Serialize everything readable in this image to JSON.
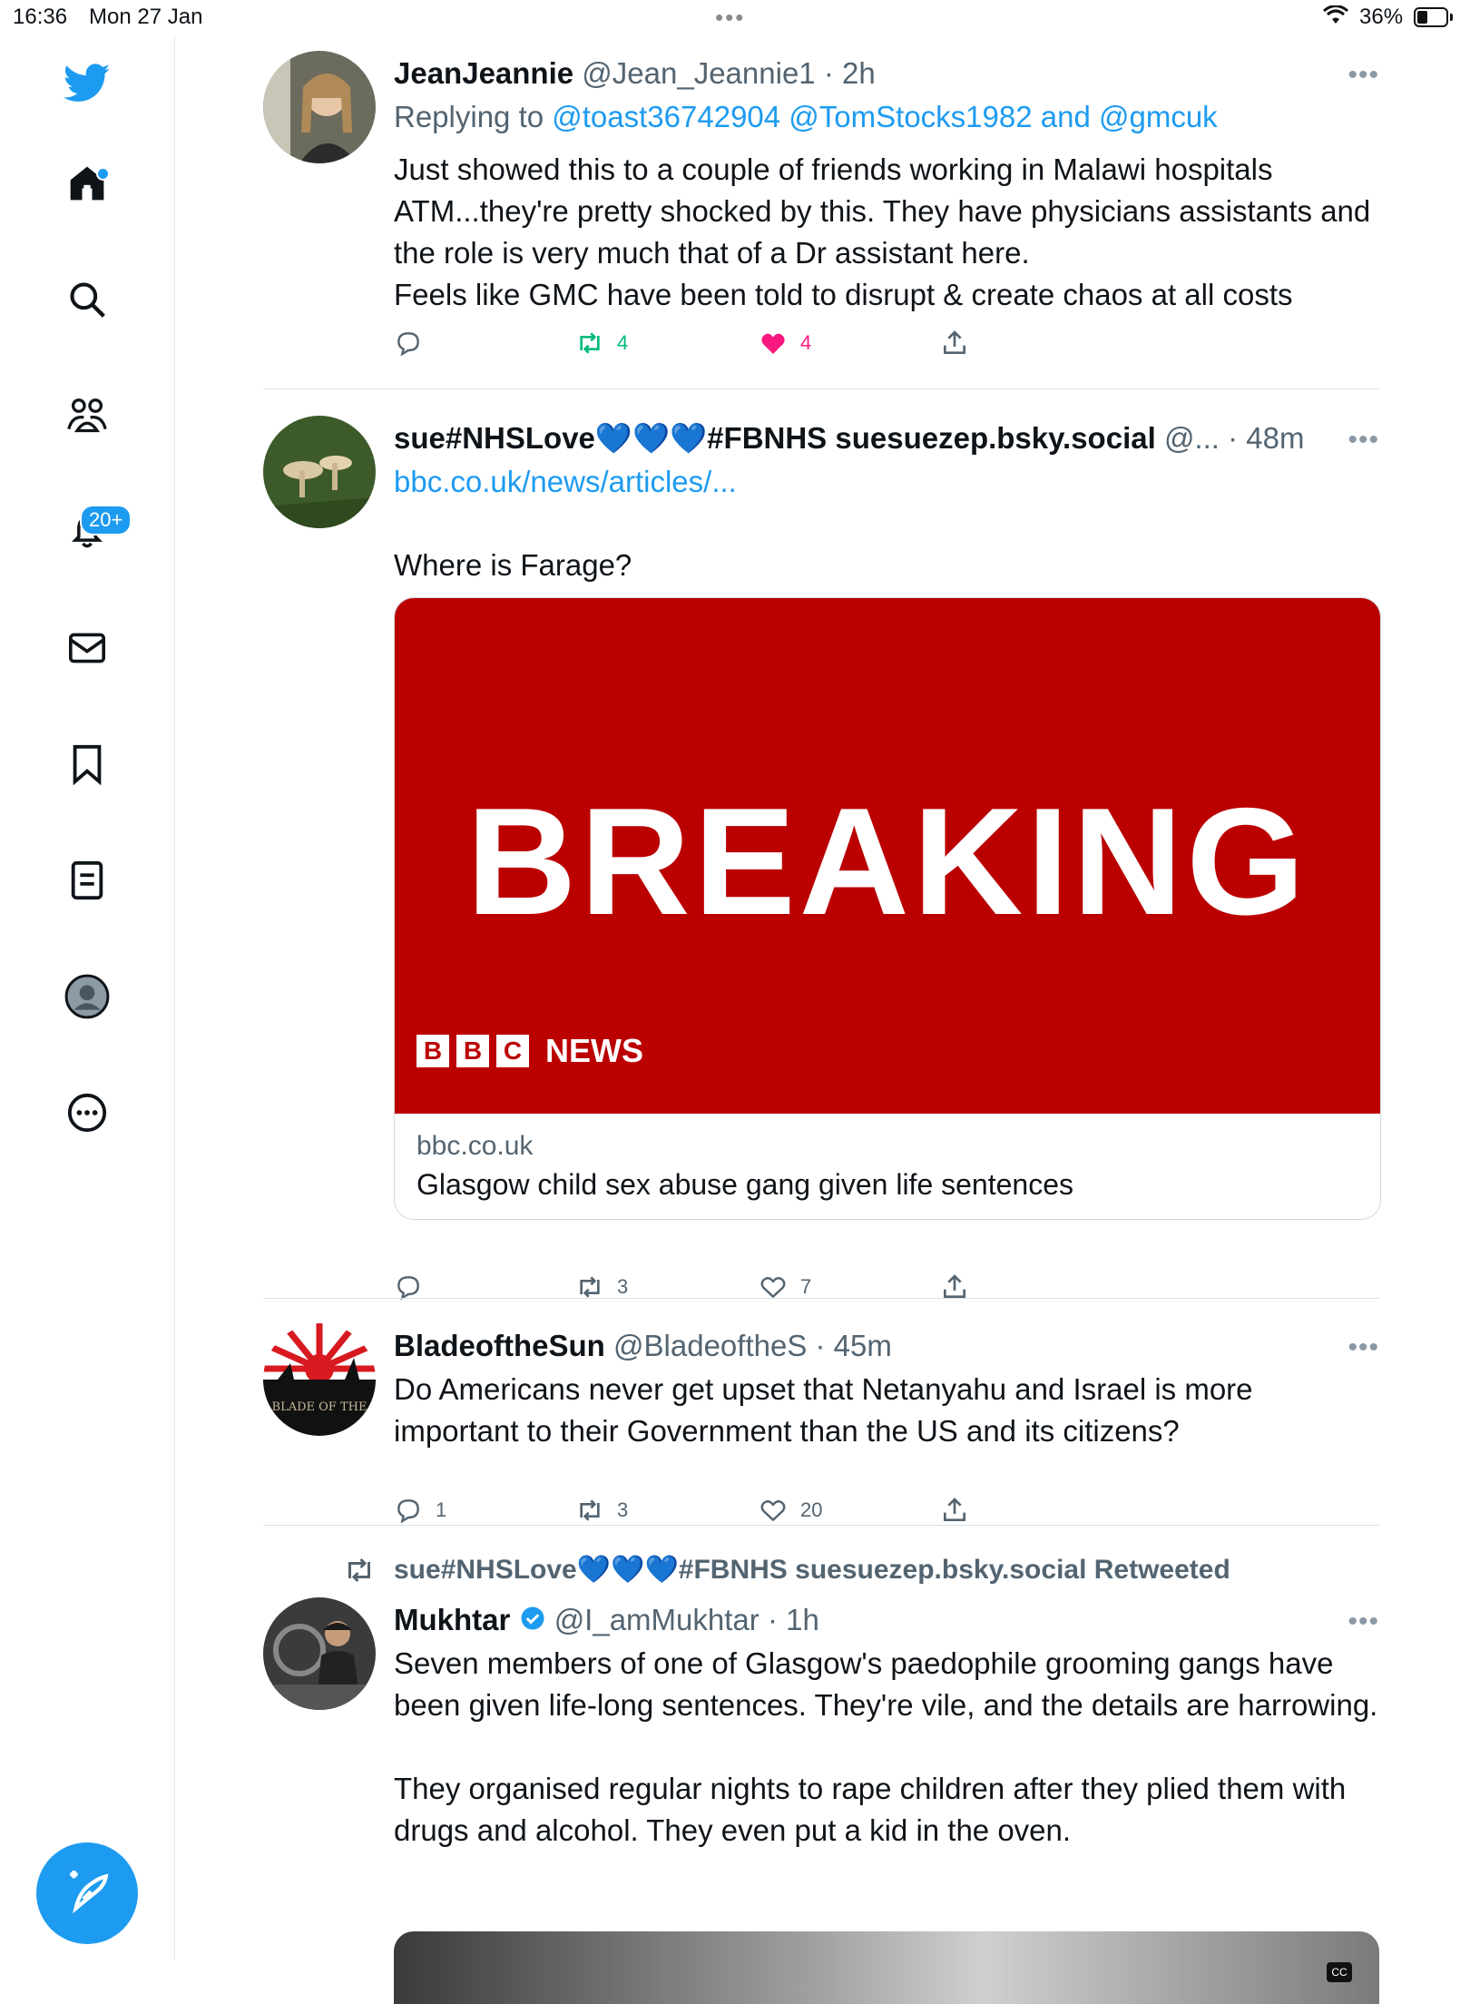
{
  "status_bar": {
    "time": "16:36",
    "date": "Mon 27 Jan",
    "battery": "36%",
    "battery_level": 0.36
  },
  "sidebar": {
    "items": [
      {
        "name": "home",
        "icon": "home-icon"
      },
      {
        "name": "search",
        "icon": "search-icon"
      },
      {
        "name": "communities",
        "icon": "communities-icon"
      },
      {
        "name": "notifications",
        "icon": "bell-icon",
        "badge": "20+"
      },
      {
        "name": "messages",
        "icon": "mail-icon"
      },
      {
        "name": "bookmarks",
        "icon": "bookmark-icon"
      },
      {
        "name": "lists",
        "icon": "list-icon"
      },
      {
        "name": "profile",
        "icon": "profile-icon"
      },
      {
        "name": "more",
        "icon": "more-circle-icon"
      }
    ],
    "logo": "twitter-bird-icon",
    "compose": "compose-icon"
  },
  "tweets": [
    {
      "name": "JeanJeannie",
      "handle": "@Jean_Jeannie1",
      "time": "· 2h",
      "replying_prefix": "Replying to ",
      "replying_to": "@toast36742904 @TomStocks1982 and @gmcuk",
      "text": "Just showed this to a couple of friends working in Malawi hospitals ATM...they're pretty shocked by this. They have physicians assistants and the role is very much that of a Dr assistant here.\nFeels like GMC have been told to disrupt & create chaos at all costs",
      "reply_count": "",
      "retweet_count": "4",
      "like_count": "4"
    },
    {
      "name": "sue#NHSLove💙💙💙#FBNHS suesuezep.bsky.social",
      "handle": "@...",
      "time": "· 48m",
      "link": "bbc.co.uk/news/articles/...",
      "text": "Where is Farage?",
      "card": {
        "image_headline": "BREAKING",
        "brand_letters": [
          "B",
          "B",
          "C"
        ],
        "brand_word": "NEWS",
        "domain": "bbc.co.uk",
        "title": "Glasgow child sex abuse gang given life sentences"
      },
      "reply_count": "",
      "retweet_count": "3",
      "like_count": "7"
    },
    {
      "name": "BladeoftheSun",
      "handle": "@BladeoftheS",
      "time": "· 45m",
      "avatar_text": "BLADE OF THE",
      "text": "Do Americans never get upset that Netanyahu and Israel is more important to their Government than the US and its citizens?",
      "reply_count": "1",
      "retweet_count": "3",
      "like_count": "20"
    },
    {
      "retweeted_by": "sue#NHSLove💙💙💙#FBNHS suesuezep.bsky.social Retweeted",
      "name": "Mukhtar",
      "handle": "@I_amMukhtar",
      "time": "· 1h",
      "text": "Seven members of one of Glasgow's paedophile grooming gangs have been given life-long sentences. They're vile, and the details are harrowing.\n\nThey organised regular nights to rape children after they plied them with drugs and alcohol. They even put a kid in the oven.",
      "media_label": "CC"
    }
  ],
  "colors": {
    "accent": "#1d9bf0",
    "retweet": "#00ba7c",
    "like": "#f91880",
    "bbc_red": "#bb0000"
  }
}
